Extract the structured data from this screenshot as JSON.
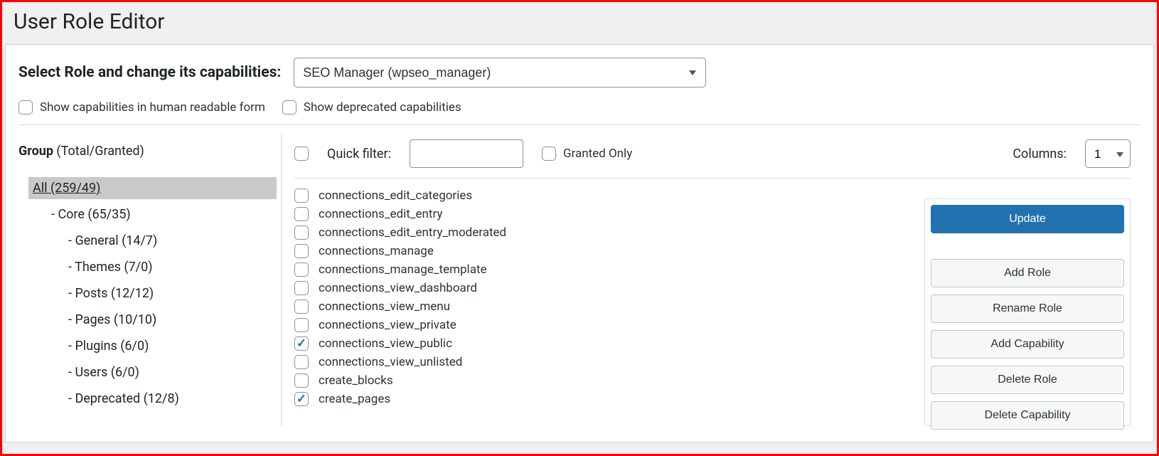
{
  "page_title": "User Role Editor",
  "select_role_label": "Select Role and change its capabilities:",
  "role_selected": "SEO Manager (wpseo_manager)",
  "options": {
    "human_readable": {
      "label": "Show capabilities in human readable form",
      "checked": false
    },
    "show_deprecated": {
      "label": "Show deprecated capabilities",
      "checked": false
    }
  },
  "group_header": {
    "bold": "Group",
    "rest": " (Total/Granted)"
  },
  "group_tree": [
    {
      "label": "All (259/49)",
      "level": 0,
      "selected": true
    },
    {
      "label": "- Core (65/35)",
      "level": 1,
      "selected": false
    },
    {
      "label": "- General (14/7)",
      "level": 2,
      "selected": false
    },
    {
      "label": "- Themes (7/0)",
      "level": 2,
      "selected": false
    },
    {
      "label": "- Posts (12/12)",
      "level": 2,
      "selected": false
    },
    {
      "label": "- Pages (10/10)",
      "level": 2,
      "selected": false
    },
    {
      "label": "- Plugins (6/0)",
      "level": 2,
      "selected": false
    },
    {
      "label": "- Users (6/0)",
      "level": 2,
      "selected": false
    },
    {
      "label": "- Deprecated (12/8)",
      "level": 2,
      "selected": false
    }
  ],
  "filter": {
    "select_all_checked": false,
    "quick_filter_label": "Quick filter:",
    "quick_filter_value": "",
    "granted_only": {
      "label": "Granted Only",
      "checked": false
    },
    "columns_label": "Columns:",
    "columns_value": "1"
  },
  "capabilities": [
    {
      "name": "connections_edit_categories",
      "checked": false
    },
    {
      "name": "connections_edit_entry",
      "checked": false
    },
    {
      "name": "connections_edit_entry_moderated",
      "checked": false
    },
    {
      "name": "connections_manage",
      "checked": false
    },
    {
      "name": "connections_manage_template",
      "checked": false
    },
    {
      "name": "connections_view_dashboard",
      "checked": false
    },
    {
      "name": "connections_view_menu",
      "checked": false
    },
    {
      "name": "connections_view_private",
      "checked": false
    },
    {
      "name": "connections_view_public",
      "checked": true
    },
    {
      "name": "connections_view_unlisted",
      "checked": false
    },
    {
      "name": "create_blocks",
      "checked": false
    },
    {
      "name": "create_pages",
      "checked": true
    }
  ],
  "actions": {
    "update": "Update",
    "add_role": "Add Role",
    "rename_role": "Rename Role",
    "add_capability": "Add Capability",
    "delete_role": "Delete Role",
    "delete_capability": "Delete Capability"
  }
}
